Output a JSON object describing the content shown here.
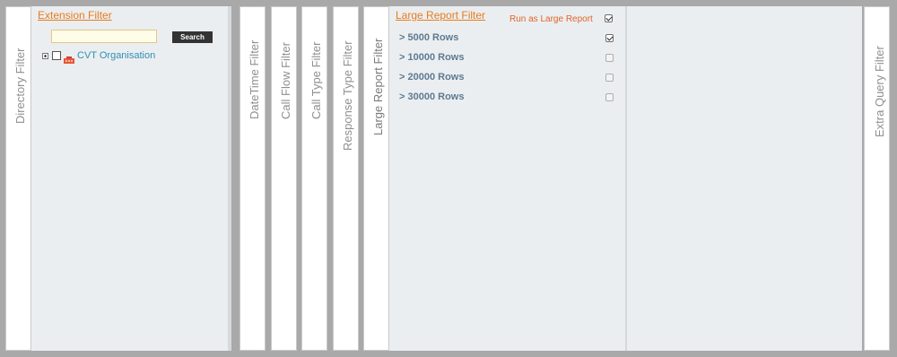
{
  "tabs": {
    "directory_filter": "Directory Filter",
    "datetime_filter": "DateTime Filter",
    "call_flow_filter": "Call Flow Filter",
    "call_type_filter": "Call Type Filter",
    "response_type_filter": "Response Type Filter",
    "large_report_filter": "Large Report Filter",
    "extra_query_filter": "Extra Query Filter"
  },
  "extension_panel": {
    "title": "Extension Filter",
    "search_value": "",
    "search_button": "Search",
    "tree": [
      {
        "label": "CVT Organisation",
        "checked": false,
        "expanded": false
      }
    ]
  },
  "large_report_panel": {
    "title": "Large Report Filter",
    "run_label": "Run as Large Report",
    "run_checked": true,
    "rows": [
      {
        "label": "> 5000 Rows",
        "checked": true
      },
      {
        "label": "> 10000 Rows",
        "checked": false
      },
      {
        "label": "> 20000 Rows",
        "checked": false
      },
      {
        "label": "> 30000 Rows",
        "checked": false
      }
    ]
  },
  "colors": {
    "accent_orange": "#e87c1e",
    "tree_link": "#2f8fb8",
    "row_text": "#5d7a92"
  }
}
